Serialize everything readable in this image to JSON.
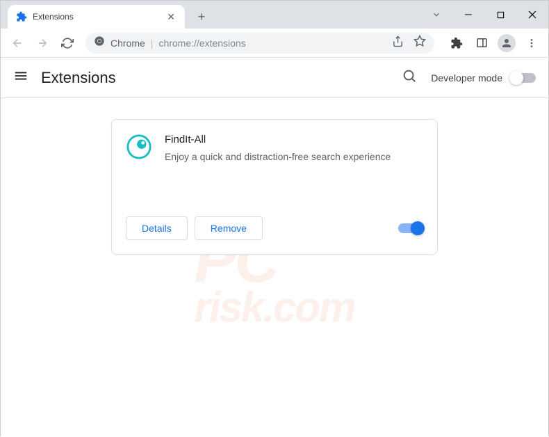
{
  "window": {
    "tab_title": "Extensions",
    "omnibox_prefix": "Chrome",
    "omnibox_url": "chrome://extensions"
  },
  "header": {
    "title": "Extensions",
    "dev_mode_label": "Developer mode"
  },
  "extension": {
    "name": "FindIt-All",
    "description": "Enjoy a quick and distraction-free search experience",
    "details_button": "Details",
    "remove_button": "Remove",
    "enabled": true
  },
  "watermark": {
    "line1": "PC",
    "line2": "risk.com"
  }
}
